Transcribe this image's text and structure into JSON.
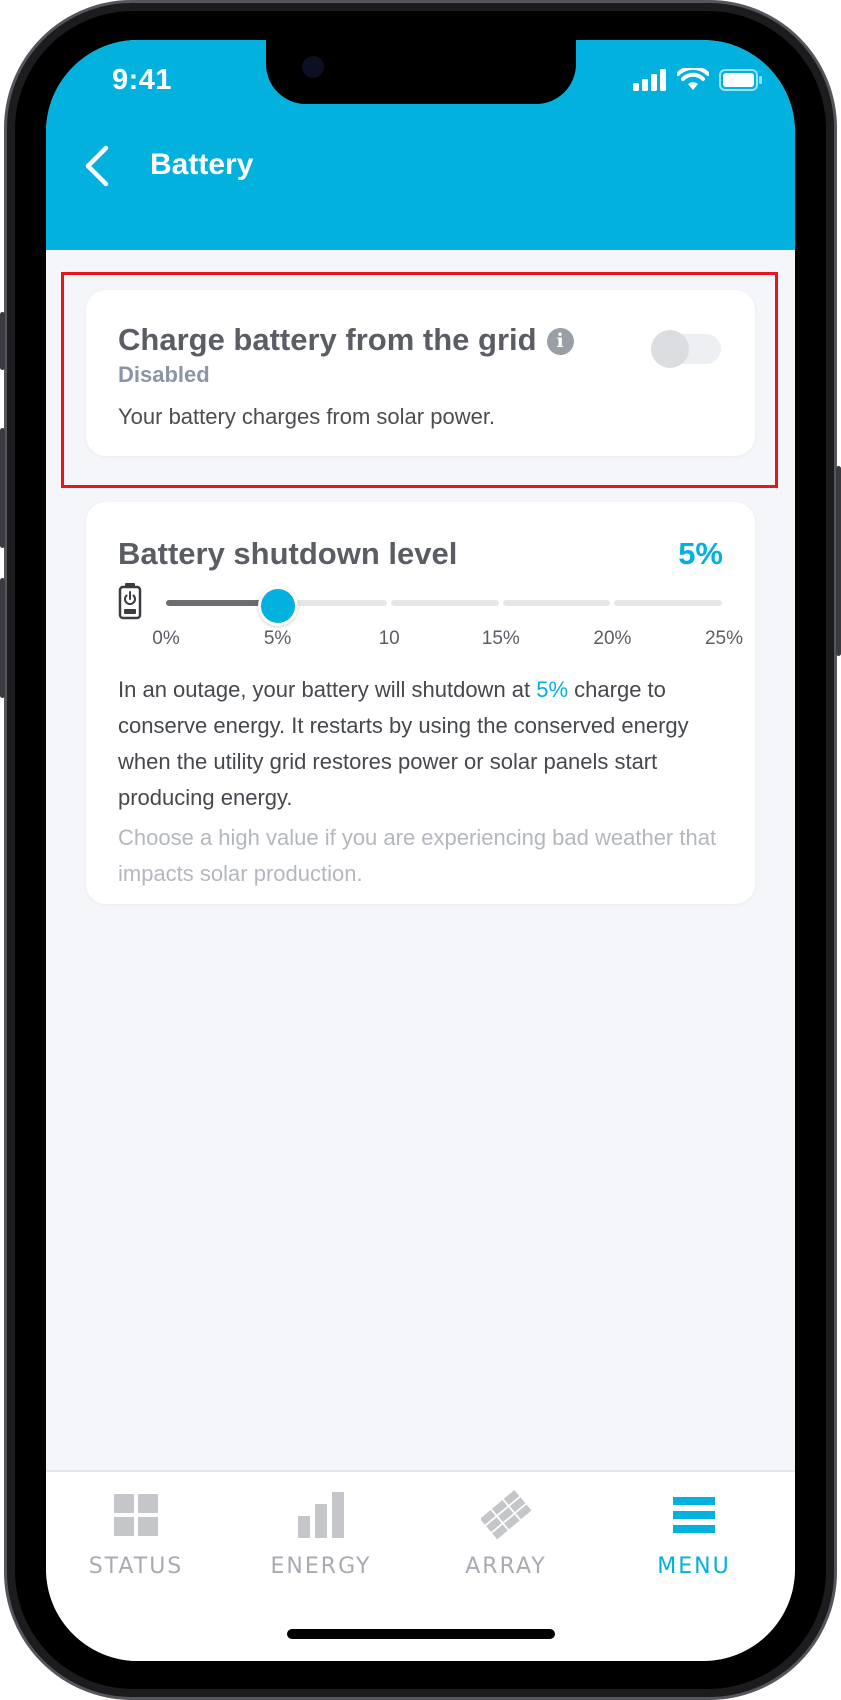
{
  "status_bar": {
    "time": "9:41"
  },
  "header": {
    "title": "Battery"
  },
  "grid_charge_card": {
    "title": "Charge battery from the grid",
    "info_glyph": "i",
    "status": "Disabled",
    "description": "Your battery charges from solar power.",
    "toggle_on": false
  },
  "shutdown_card": {
    "title": "Battery shutdown level",
    "value_label": "5%",
    "slider": {
      "min": 0,
      "max": 25,
      "value": 5,
      "ticks": [
        "0%",
        "5%",
        "10",
        "15%",
        "20%",
        "25%"
      ]
    },
    "body_before": "In an outage, your battery will shutdown at ",
    "body_highlight": "5%",
    "body_after": " charge to conserve energy. It restarts by using the conserved energy when the utility grid restores power or solar panels start producing energy.",
    "hint": "Choose a high value if you are experiencing bad weather that impacts solar production."
  },
  "tabs": [
    {
      "label": "STATUS",
      "icon": "grid-icon",
      "active": false
    },
    {
      "label": "ENERGY",
      "icon": "bar-chart-icon",
      "active": false
    },
    {
      "label": "ARRAY",
      "icon": "solar-array-icon",
      "active": false
    },
    {
      "label": "MENU",
      "icon": "hamburger-icon",
      "active": true
    }
  ],
  "colors": {
    "accent": "#02b1dd",
    "highlight_border": "#e8161c",
    "background": "#f4f6fa"
  }
}
